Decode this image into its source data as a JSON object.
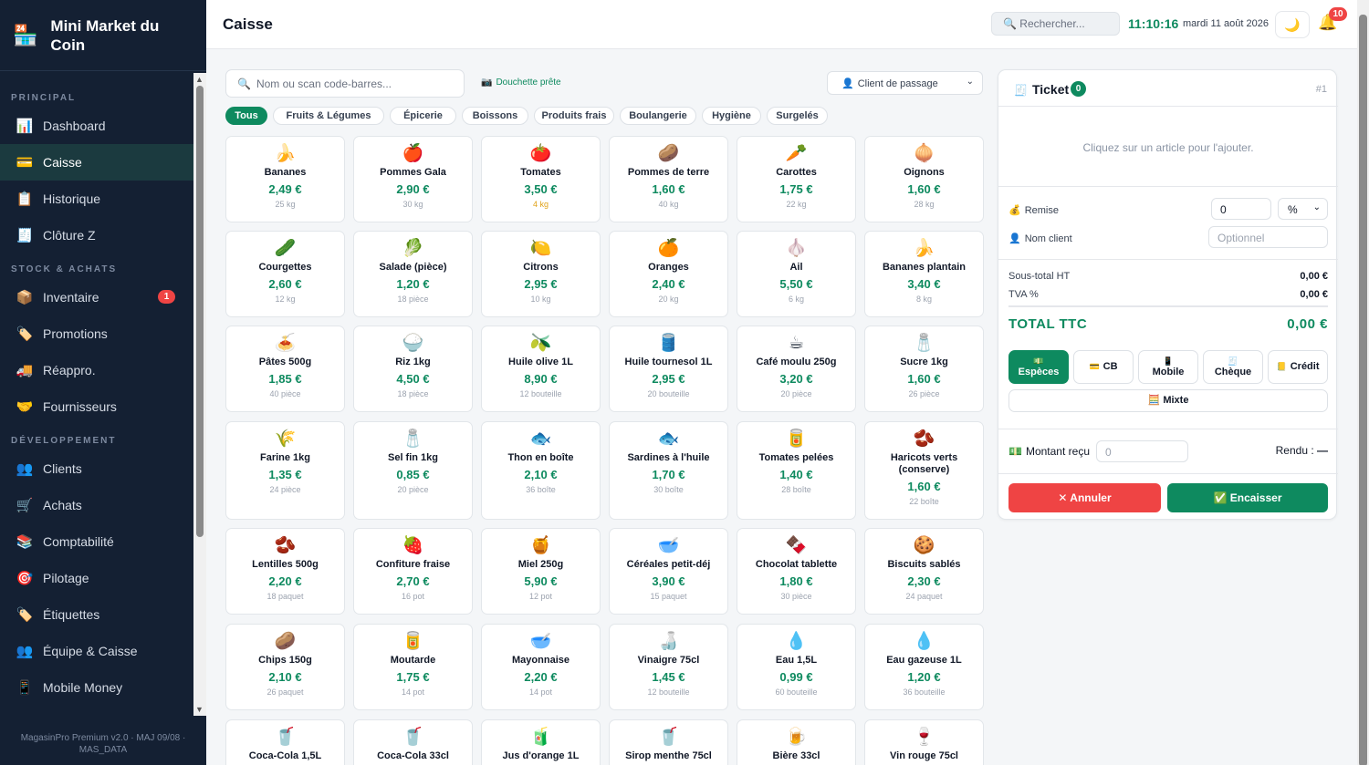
{
  "app": {
    "brand": "Mini Market du Coin",
    "footer": "MagasinPro Premium v2.0 · MAJ 09/08 · MAS_DATA"
  },
  "sidebar": {
    "sections": [
      {
        "label": "PRINCIPAL",
        "items": [
          {
            "icon": "📊",
            "label": "Dashboard"
          },
          {
            "icon": "💳",
            "label": "Caisse",
            "active": true
          },
          {
            "icon": "📋",
            "label": "Historique"
          },
          {
            "icon": "🧾",
            "label": "Clôture Z"
          }
        ]
      },
      {
        "label": "STOCK & ACHATS",
        "items": [
          {
            "icon": "📦",
            "label": "Inventaire",
            "badge": "1"
          },
          {
            "icon": "🏷️",
            "label": "Promotions"
          },
          {
            "icon": "🚚",
            "label": "Réappro."
          },
          {
            "icon": "🤝",
            "label": "Fournisseurs"
          }
        ]
      },
      {
        "label": "DÉVELOPPEMENT",
        "items": [
          {
            "icon": "👥",
            "label": "Clients"
          },
          {
            "icon": "🛒",
            "label": "Achats"
          },
          {
            "icon": "📚",
            "label": "Comptabilité"
          },
          {
            "icon": "🎯",
            "label": "Pilotage"
          },
          {
            "icon": "🏷️",
            "label": "Étiquettes"
          },
          {
            "icon": "👥",
            "label": "Équipe & Caisse"
          },
          {
            "icon": "📱",
            "label": "Mobile Money"
          }
        ]
      }
    ]
  },
  "topbar": {
    "title": "Caisse",
    "search_placeholder": "Rechercher...",
    "time": "11:10:16",
    "date": "mardi 11 août 2026",
    "notif_count": "10"
  },
  "pos": {
    "product_search_placeholder": "Nom ou scan code-barres...",
    "scanner_status": "Douchette prête",
    "client_select": "Client de passage",
    "categories": [
      "Tous",
      "Fruits & Légumes",
      "Épicerie",
      "Boissons",
      "Produits frais",
      "Boulangerie",
      "Hygiène",
      "Surgelés"
    ],
    "active_category": "Tous",
    "products": [
      {
        "icon": "🍌",
        "name": "Bananes",
        "price": "2,49 €",
        "stock": "25 kg"
      },
      {
        "icon": "🍎",
        "name": "Pommes Gala",
        "price": "2,90 €",
        "stock": "30 kg"
      },
      {
        "icon": "🍅",
        "name": "Tomates",
        "price": "3,50 €",
        "stock": "4 kg",
        "low": true
      },
      {
        "icon": "🥔",
        "name": "Pommes de terre",
        "price": "1,60 €",
        "stock": "40 kg"
      },
      {
        "icon": "🥕",
        "name": "Carottes",
        "price": "1,75 €",
        "stock": "22 kg"
      },
      {
        "icon": "🧅",
        "name": "Oignons",
        "price": "1,60 €",
        "stock": "28 kg"
      },
      {
        "icon": "🥒",
        "name": "Courgettes",
        "price": "2,60 €",
        "stock": "12 kg"
      },
      {
        "icon": "🥬",
        "name": "Salade (pièce)",
        "price": "1,20 €",
        "stock": "18 pièce"
      },
      {
        "icon": "🍋",
        "name": "Citrons",
        "price": "2,95 €",
        "stock": "10 kg"
      },
      {
        "icon": "🍊",
        "name": "Oranges",
        "price": "2,40 €",
        "stock": "20 kg"
      },
      {
        "icon": "🧄",
        "name": "Ail",
        "price": "5,50 €",
        "stock": "6 kg"
      },
      {
        "icon": "🍌",
        "name": "Bananes plantain",
        "price": "3,40 €",
        "stock": "8 kg"
      },
      {
        "icon": "🍝",
        "name": "Pâtes 500g",
        "price": "1,85 €",
        "stock": "40 pièce"
      },
      {
        "icon": "🍚",
        "name": "Riz 1kg",
        "price": "4,50 €",
        "stock": "18 pièce"
      },
      {
        "icon": "🫒",
        "name": "Huile olive 1L",
        "price": "8,90 €",
        "stock": "12 bouteille"
      },
      {
        "icon": "🛢️",
        "name": "Huile tournesol 1L",
        "price": "2,95 €",
        "stock": "20 bouteille"
      },
      {
        "icon": "☕",
        "name": "Café moulu 250g",
        "price": "3,20 €",
        "stock": "20 pièce"
      },
      {
        "icon": "🧂",
        "name": "Sucre 1kg",
        "price": "1,60 €",
        "stock": "26 pièce"
      },
      {
        "icon": "🌾",
        "name": "Farine 1kg",
        "price": "1,35 €",
        "stock": "24 pièce"
      },
      {
        "icon": "🧂",
        "name": "Sel fin 1kg",
        "price": "0,85 €",
        "stock": "20 pièce"
      },
      {
        "icon": "🐟",
        "name": "Thon en boîte",
        "price": "2,10 €",
        "stock": "36 boîte"
      },
      {
        "icon": "🐟",
        "name": "Sardines à l'huile",
        "price": "1,70 €",
        "stock": "30 boîte"
      },
      {
        "icon": "🥫",
        "name": "Tomates pelées",
        "price": "1,40 €",
        "stock": "28 boîte"
      },
      {
        "icon": "🫘",
        "name": "Haricots verts (conserve)",
        "price": "1,60 €",
        "stock": "22 boîte"
      },
      {
        "icon": "🫘",
        "name": "Lentilles 500g",
        "price": "2,20 €",
        "stock": "18 paquet"
      },
      {
        "icon": "🍓",
        "name": "Confiture fraise",
        "price": "2,70 €",
        "stock": "16 pot"
      },
      {
        "icon": "🍯",
        "name": "Miel 250g",
        "price": "5,90 €",
        "stock": "12 pot"
      },
      {
        "icon": "🥣",
        "name": "Céréales petit-déj",
        "price": "3,90 €",
        "stock": "15 paquet"
      },
      {
        "icon": "🍫",
        "name": "Chocolat tablette",
        "price": "1,80 €",
        "stock": "30 pièce"
      },
      {
        "icon": "🍪",
        "name": "Biscuits sablés",
        "price": "2,30 €",
        "stock": "24 paquet"
      },
      {
        "icon": "🥔",
        "name": "Chips 150g",
        "price": "2,10 €",
        "stock": "26 paquet"
      },
      {
        "icon": "🥫",
        "name": "Moutarde",
        "price": "1,75 €",
        "stock": "14 pot"
      },
      {
        "icon": "🥣",
        "name": "Mayonnaise",
        "price": "2,20 €",
        "stock": "14 pot"
      },
      {
        "icon": "🍶",
        "name": "Vinaigre 75cl",
        "price": "1,45 €",
        "stock": "12 bouteille"
      },
      {
        "icon": "💧",
        "name": "Eau 1,5L",
        "price": "0,99 €",
        "stock": "60 bouteille"
      },
      {
        "icon": "💧",
        "name": "Eau gazeuse 1L",
        "price": "1,20 €",
        "stock": "36 bouteille"
      },
      {
        "icon": "🥤",
        "name": "Coca-Cola 1,5L",
        "price": "",
        "stock": ""
      },
      {
        "icon": "🥤",
        "name": "Coca-Cola 33cl",
        "price": "",
        "stock": ""
      },
      {
        "icon": "🧃",
        "name": "Jus d'orange 1L",
        "price": "",
        "stock": ""
      },
      {
        "icon": "🥤",
        "name": "Sirop menthe 75cl",
        "price": "",
        "stock": ""
      },
      {
        "icon": "🍺",
        "name": "Bière 33cl",
        "price": "",
        "stock": ""
      },
      {
        "icon": "🍷",
        "name": "Vin rouge 75cl",
        "price": "",
        "stock": ""
      }
    ]
  },
  "ticket": {
    "title": "Ticket",
    "count": "0",
    "number": "#1",
    "empty_message": "Cliquez sur un article pour l'ajouter.",
    "discount_label": "Remise",
    "discount_value": "0",
    "discount_unit": "%",
    "client_name_label": "Nom client",
    "client_name_placeholder": "Optionnel",
    "subtotal_label": "Sous-total HT",
    "subtotal": "0,00 €",
    "tva_label": "TVA %",
    "tva": "0,00 €",
    "total_label": "TOTAL TTC",
    "total": "0,00 €",
    "payment_methods": [
      {
        "icon": "💵",
        "label": "Espèces"
      },
      {
        "icon": "💳",
        "label": "CB"
      },
      {
        "icon": "📱",
        "label": "Mobile"
      },
      {
        "icon": "🧾",
        "label": "Chèque"
      },
      {
        "icon": "📒",
        "label": "Crédit"
      }
    ],
    "mixed_icon": "🧮",
    "mixed_label": "Mixte",
    "received_icon": "💵",
    "received_label": "Montant reçu",
    "received_placeholder": "0",
    "change_label": "Rendu :",
    "change_value": "—",
    "cancel_icon": "✕",
    "cancel_label": "Annuler",
    "checkout_icon": "✅",
    "checkout_label": "Encaisser"
  }
}
